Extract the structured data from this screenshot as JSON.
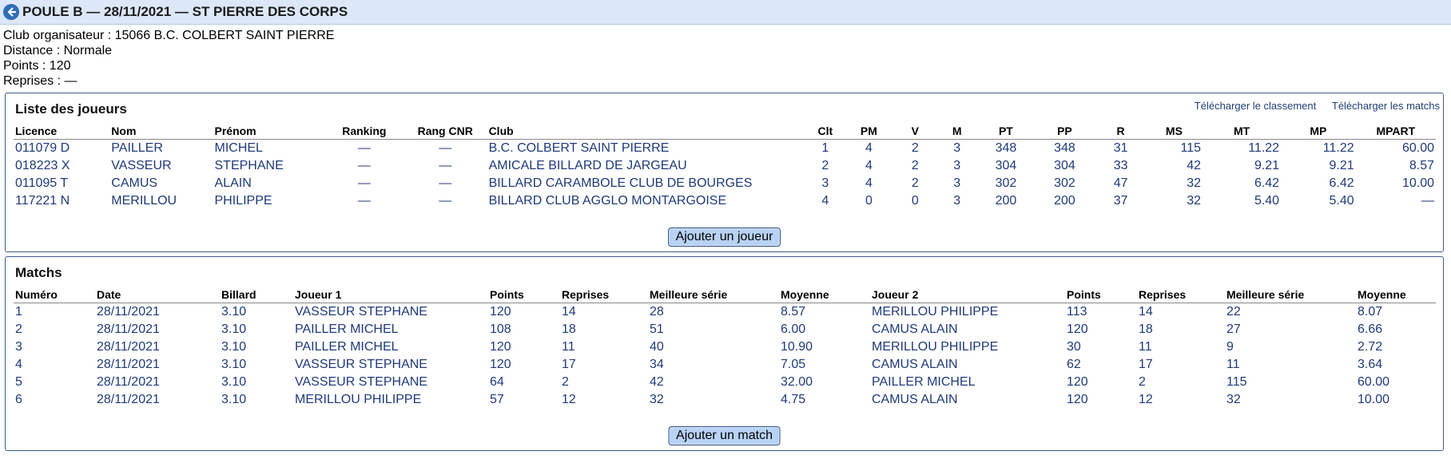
{
  "header": {
    "title": "POULE B — 28/11/2021 — ST PIERRE DES CORPS"
  },
  "info": {
    "club": "Club organisateur : 15066 B.C. COLBERT SAINT PIERRE",
    "distance": "Distance : Normale",
    "points": "Points : 120",
    "reprises": "Reprises : —"
  },
  "players": {
    "title": "Liste des joueurs",
    "download_ranking": "Télécharger le classement",
    "download_matches": "Télécharger les matchs",
    "columns": [
      "Licence",
      "Nom",
      "Prénom",
      "Ranking",
      "Rang CNR",
      "Club",
      "Clt",
      "PM",
      "V",
      "M",
      "PT",
      "PP",
      "R",
      "MS",
      "MT",
      "MP",
      "MPART"
    ],
    "rows": [
      [
        "011079 D",
        "PAILLER",
        "MICHEL",
        "—",
        "—",
        "B.C. COLBERT SAINT PIERRE",
        "1",
        "4",
        "2",
        "3",
        "348",
        "348",
        "31",
        "115",
        "11.22",
        "11.22",
        "60.00"
      ],
      [
        "018223 X",
        "VASSEUR",
        "STEPHANE",
        "—",
        "—",
        "AMICALE BILLARD DE JARGEAU",
        "2",
        "4",
        "2",
        "3",
        "304",
        "304",
        "33",
        "42",
        "9.21",
        "9.21",
        "8.57"
      ],
      [
        "011095 T",
        "CAMUS",
        "ALAIN",
        "—",
        "—",
        "BILLARD CARAMBOLE CLUB DE BOURGES",
        "3",
        "4",
        "2",
        "3",
        "302",
        "302",
        "47",
        "32",
        "6.42",
        "6.42",
        "10.00"
      ],
      [
        "117221 N",
        "MERILLOU",
        "PHILIPPE",
        "—",
        "—",
        "BILLARD CLUB AGGLO MONTARGOISE",
        "4",
        "0",
        "0",
        "3",
        "200",
        "200",
        "37",
        "32",
        "5.40",
        "5.40",
        "—"
      ]
    ],
    "add_button": "Ajouter un joueur"
  },
  "matches": {
    "title": "Matchs",
    "columns": [
      "Numéro",
      "Date",
      "Billard",
      "Joueur 1",
      "Points",
      "Reprises",
      "Meilleure série",
      "Moyenne",
      "Joueur 2",
      "Points",
      "Reprises",
      "Meilleure série",
      "Moyenne"
    ],
    "rows": [
      [
        "1",
        "28/11/2021",
        "3.10",
        "VASSEUR STEPHANE",
        "120",
        "14",
        "28",
        "8.57",
        "MERILLOU PHILIPPE",
        "113",
        "14",
        "22",
        "8.07"
      ],
      [
        "2",
        "28/11/2021",
        "3.10",
        "PAILLER MICHEL",
        "108",
        "18",
        "51",
        "6.00",
        "CAMUS ALAIN",
        "120",
        "18",
        "27",
        "6.66"
      ],
      [
        "3",
        "28/11/2021",
        "3.10",
        "PAILLER MICHEL",
        "120",
        "11",
        "40",
        "10.90",
        "MERILLOU PHILIPPE",
        "30",
        "11",
        "9",
        "2.72"
      ],
      [
        "4",
        "28/11/2021",
        "3.10",
        "VASSEUR STEPHANE",
        "120",
        "17",
        "34",
        "7.05",
        "CAMUS ALAIN",
        "62",
        "17",
        "11",
        "3.64"
      ],
      [
        "5",
        "28/11/2021",
        "3.10",
        "VASSEUR STEPHANE",
        "64",
        "2",
        "42",
        "32.00",
        "PAILLER MICHEL",
        "120",
        "2",
        "115",
        "60.00"
      ],
      [
        "6",
        "28/11/2021",
        "3.10",
        "MERILLOU PHILIPPE",
        "57",
        "12",
        "32",
        "4.75",
        "CAMUS ALAIN",
        "120",
        "12",
        "32",
        "10.00"
      ]
    ],
    "add_button": "Ajouter un match"
  },
  "colors": {
    "title_bar": "#dce7f7",
    "accent": "#2f6db5",
    "link_text": "#1f3a7a",
    "button_bg": "#b8d2f5"
  },
  "icons": {
    "back": "back-arrow-icon"
  }
}
